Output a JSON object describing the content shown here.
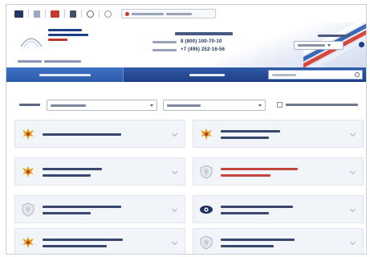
{
  "toolbar": {
    "icons": [
      "toolbar-menu-icon",
      "toolbar-contrast-icon",
      "toolbar-mail-icon",
      "toolbar-chart-icon",
      "toolbar-search-icon",
      "toolbar-settings-icon"
    ],
    "address_text": "",
    "colors": {
      "accent": "#1f3f86",
      "warning": "#c9342f"
    }
  },
  "header": {
    "logo_text": "",
    "logo_subtext": "",
    "phones": {
      "caption": "",
      "items": [
        {
          "label": "",
          "number": "8 (800) 100-70-10"
        },
        {
          "label": "",
          "number": "+7 (495) 252-16-56"
        }
      ]
    },
    "language": {
      "caption": "",
      "selected": ""
    }
  },
  "nav": {
    "tabs": [
      {
        "label": "",
        "active": true
      },
      {
        "label": "",
        "active": false
      }
    ],
    "search_placeholder": ""
  },
  "filters": {
    "label": "",
    "select_one": "",
    "select_two": "",
    "checkbox_label": "",
    "checkbox_checked": false
  },
  "ministries": [
    {
      "name": "",
      "emblem": "eagle-icon",
      "highlight": false
    },
    {
      "name": "",
      "emblem": "eagle-icon",
      "highlight": false
    },
    {
      "name": "",
      "emblem": "eagle-icon",
      "highlight": false
    },
    {
      "name": "",
      "emblem": "shield-icon",
      "highlight": true
    },
    {
      "name": "",
      "emblem": "shield-icon",
      "highlight": false
    },
    {
      "name": "",
      "emblem": "eye-icon",
      "highlight": false
    },
    {
      "name": "",
      "emblem": "eagle-icon",
      "highlight": false
    },
    {
      "name": "",
      "emblem": "shield-icon",
      "highlight": false
    }
  ]
}
